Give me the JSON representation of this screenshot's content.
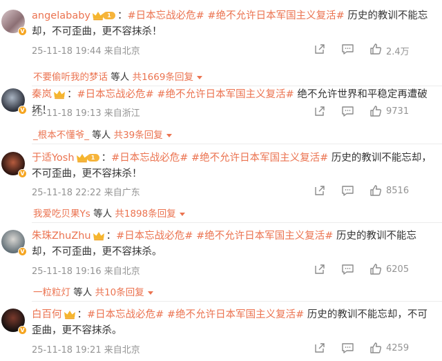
{
  "colors": {
    "accent": "#eb7350",
    "meta": "#939393",
    "text": "#333333"
  },
  "comments": [
    {
      "username": "angelababy",
      "badge": "rank",
      "rank_level": "1",
      "sep": "：",
      "tags": [
        "#日本忘战必危#",
        "#绝不允许日本军国主义复活#"
      ],
      "body": "历史的教训不能忘却，不可歪曲，更不容抹杀！",
      "date": "25-11-18 19:44",
      "source": "来自北京",
      "likes": "2.4万",
      "reply_user": "不要偷听我的梦话",
      "reply_mid": "等人",
      "reply_count": "共1669条回复"
    },
    {
      "username": "秦岚",
      "badge": "crown",
      "sep": "：",
      "tags": [
        "#日本忘战必危#",
        "#绝不允许日本军国主义复活#"
      ],
      "body": "绝不允许世界和平稳定再遭破坏！",
      "date": "25-11-18 19:13",
      "source": "来自浙江",
      "likes": "9731",
      "reply_user": "_根本不懂爷_",
      "reply_mid": "等人",
      "reply_count": "共39条回复"
    },
    {
      "username": "于适Yosh",
      "badge": "rank",
      "rank_level": "1",
      "sep": "：",
      "tags": [
        "#日本忘战必危#",
        "#绝不允许日本军国主义复活#"
      ],
      "body": "历史的教训不能忘却，不可歪曲，更不容抹杀！",
      "date": "25-11-18 22:22",
      "source": "来自广东",
      "likes": "8516",
      "reply_user": "我爱吃贝果Ys",
      "reply_mid": "等人",
      "reply_count": "共1898条回复"
    },
    {
      "username": "朱珠ZhuZhu",
      "badge": "crown",
      "sep": "：",
      "tags": [
        "#日本忘战必危#",
        "#绝不允许日本军国主义复活#"
      ],
      "body": "历史的教训不能忘却，不可歪曲，更不容抹杀。",
      "date": "25-11-18 19:16",
      "source": "来自北京",
      "likes": "6205",
      "reply_user": "一粒粒灯",
      "reply_mid": "等人",
      "reply_count": "共10条回复"
    },
    {
      "username": "白百何",
      "badge": "crown",
      "sep": "：",
      "tags": [
        "#日本忘战必危#",
        "#绝不允许日本军国主义复活#"
      ],
      "body": "历史的教训不能忘却，不可歪曲，更不容抹杀。",
      "date": "25-11-18 19:21",
      "source": "来自北京",
      "likes": "4259",
      "reply_user": "",
      "reply_mid": "",
      "reply_count": ""
    }
  ]
}
